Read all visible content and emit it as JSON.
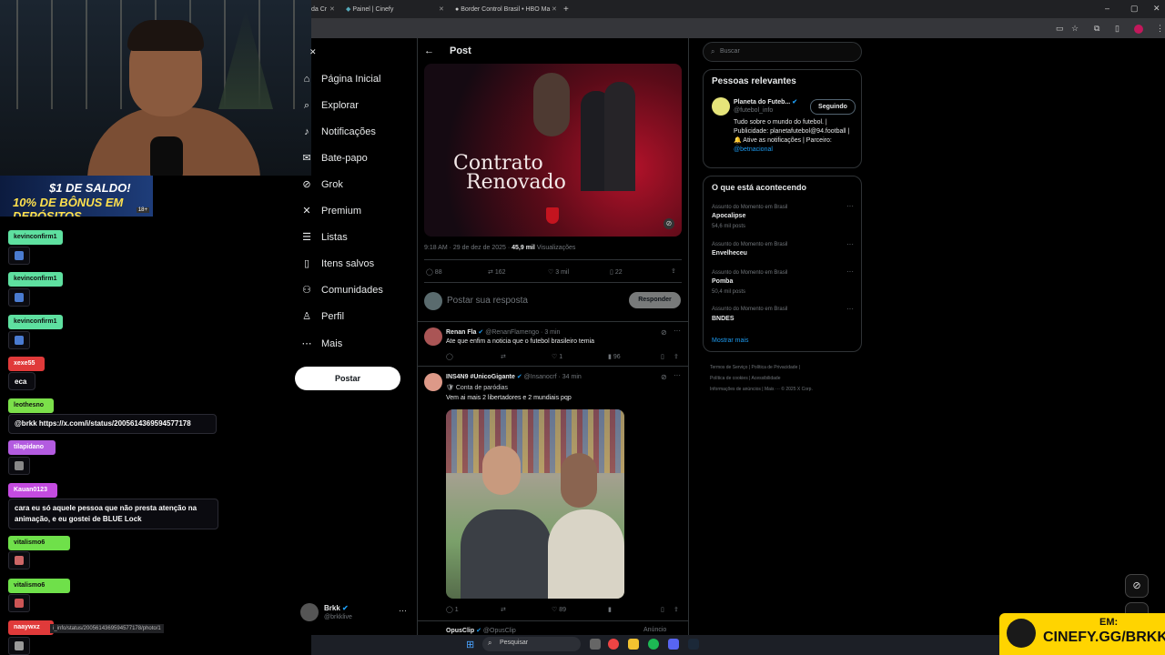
{
  "browser": {
    "tabs": [
      {
        "label": "da Cr"
      },
      {
        "label": "Painel | Cinefy"
      },
      {
        "label": "Border Control Brasil • HBO Ma"
      }
    ],
    "new_tab_label": "+",
    "window_controls": [
      "–",
      "▢",
      "✕"
    ]
  },
  "overlay": {
    "banner_line1": "$1 DE SALDO!",
    "banner_line2": "10% DE BÔNUS EM DEPÓSITOS",
    "banner_tag": "18+",
    "chat": [
      {
        "user": "kevinconfirm1",
        "color": "#5ee0a0"
      },
      {
        "user": "kevinconfirm1",
        "color": "#5ee0a0"
      },
      {
        "user": "kevinconfirm1",
        "color": "#5ee0a0"
      },
      {
        "user": "xexe55",
        "color": "#e03a3a",
        "message": "eca"
      },
      {
        "user": "leothesno",
        "color": "#7be04a",
        "message": "@brkk https://x.com/i/status/2005614369594577178"
      },
      {
        "user": "tilapidano",
        "color": "#b35be0"
      },
      {
        "user": "Kauan0123",
        "color": "#c44be0",
        "message": "cara eu só aquele pessoa que não presta atenção na animação, e eu gostei de BLUE Lock"
      },
      {
        "user": "vitalismo6",
        "color": "#6fe04a"
      },
      {
        "user": "vitalismo6",
        "color": "#6fe04a"
      },
      {
        "user": "naaywxz",
        "color": "#e03a3a"
      }
    ],
    "cinefy_line1": "EM:",
    "cinefy_line2": "CINEFY.GG/BRKK"
  },
  "nav": {
    "items": [
      {
        "label": "Página Inicial",
        "icon": "home-icon",
        "glyph": "⌂"
      },
      {
        "label": "Explorar",
        "icon": "search-icon",
        "glyph": "⌕"
      },
      {
        "label": "Notificações",
        "icon": "bell-icon",
        "glyph": "♪"
      },
      {
        "label": "Bate-papo",
        "icon": "mail-icon",
        "glyph": "✉"
      },
      {
        "label": "Grok",
        "icon": "grok-icon",
        "glyph": "⊘"
      },
      {
        "label": "Premium",
        "icon": "x-logo-icon",
        "glyph": "✕"
      },
      {
        "label": "Listas",
        "icon": "list-icon",
        "glyph": "☰"
      },
      {
        "label": "Itens salvos",
        "icon": "bookmark-icon",
        "glyph": "▯"
      },
      {
        "label": "Comunidades",
        "icon": "communities-icon",
        "glyph": "⚇"
      },
      {
        "label": "Perfil",
        "icon": "profile-icon",
        "glyph": "♙"
      },
      {
        "label": "Mais",
        "icon": "more-icon",
        "glyph": "⋯"
      }
    ],
    "post_button": "Postar",
    "account": {
      "name": "Brkk",
      "handle": "@brkklive"
    }
  },
  "post": {
    "header_title": "Post",
    "image_text_line1": "Contrato",
    "image_text_line2": "Renovado",
    "meta_time": "9:18 AM · 29 de dez de 2025 · ",
    "meta_views": "45,9 mil",
    "meta_views_label": " Visualizações",
    "stats": {
      "replies": "88",
      "reposts": "162",
      "likes": "3 mil",
      "bookmarks": "22"
    },
    "reply_placeholder": "Postar sua resposta",
    "reply_button": "Responder"
  },
  "replies": [
    {
      "name": "Renan Fla",
      "handle": "@RenanFlamengo · 3 min",
      "text": "Ate que enfim a noticia que o futebol brasileiro temia",
      "likes": "1",
      "views": "96"
    },
    {
      "name": "INS4N9 #UnicoGigante",
      "handle": "@Insanocrf · 34 min",
      "tag": "Conta de paródias",
      "text": "Vem ai mais 2 libertadores e 2 mundiais pqp",
      "replies": "1",
      "likes": "89"
    },
    {
      "name": "OpusClip",
      "handle": "@OpusClip",
      "ad": "Anúncio"
    }
  ],
  "sidebar": {
    "search_placeholder": "Buscar",
    "relevant_title": "Pessoas relevantes",
    "person": {
      "name": "Planeta do Futeb...",
      "handle": "@futebol_info",
      "follow": "Seguindo",
      "bio": "Tudo sobre o mundo do futebol. | Publicidade: planetafutebol@94.football | 🔔 Ative as notificações | Parceiro:",
      "bio_link": "@betnacional"
    },
    "trends_title": "O que está acontecendo",
    "trends": [
      {
        "meta": "Assunto do Momento em Brasil",
        "title": "Apocalipse",
        "count": "54,6 mil posts"
      },
      {
        "meta": "Assunto do Momento em Brasil",
        "title": "Envelheceu",
        "count": ""
      },
      {
        "meta": "Assunto do Momento em Brasil",
        "title": "Pomba",
        "count": "50,4 mil posts"
      },
      {
        "meta": "Assunto do Momento em Brasil",
        "title": "BNDES",
        "count": ""
      }
    ],
    "show_more": "Mostrar mais",
    "footer": [
      "Termos de Serviço",
      "Política de Privacidade",
      "Política de cookies",
      "Acessibilidade",
      "Informações de anúncios",
      "Mais ···",
      "© 2025 X Corp."
    ]
  },
  "statusbar_url": "i_info/status/2005614369594577178/photo/1",
  "taskbar": {
    "search_label": "Pesquisar"
  }
}
